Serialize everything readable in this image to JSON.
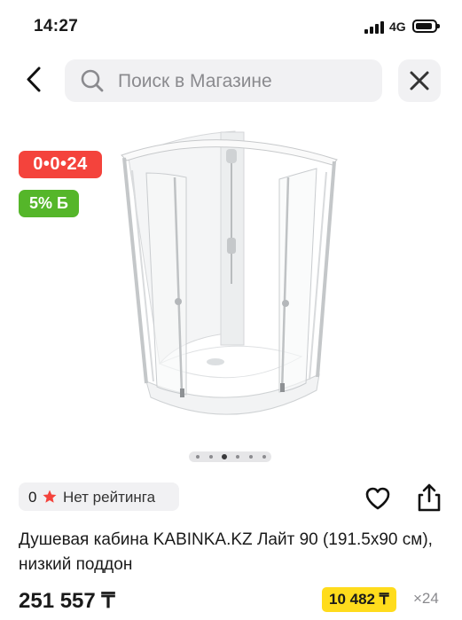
{
  "status_bar": {
    "time": "14:27",
    "network": "4G"
  },
  "search": {
    "placeholder": "Поиск в Магазине"
  },
  "badges": {
    "timer": "0•0•24",
    "cashback": "5% Б"
  },
  "gallery": {
    "count": 6,
    "active": 2
  },
  "rating": {
    "count": "0",
    "label": "Нет рейтинга"
  },
  "product": {
    "title": "Душевая кабина KABINKA.KZ Лайт 90 (191.5x90 см), низкий поддон",
    "price": "251 557 ₸",
    "installment_price": "10 482 ₸",
    "installment_months": "×24"
  },
  "colors": {
    "timer_badge": "#f4433c",
    "cashback_badge": "#55b62a",
    "installment_badge": "#ffdc1c",
    "star": "#f4433c"
  }
}
